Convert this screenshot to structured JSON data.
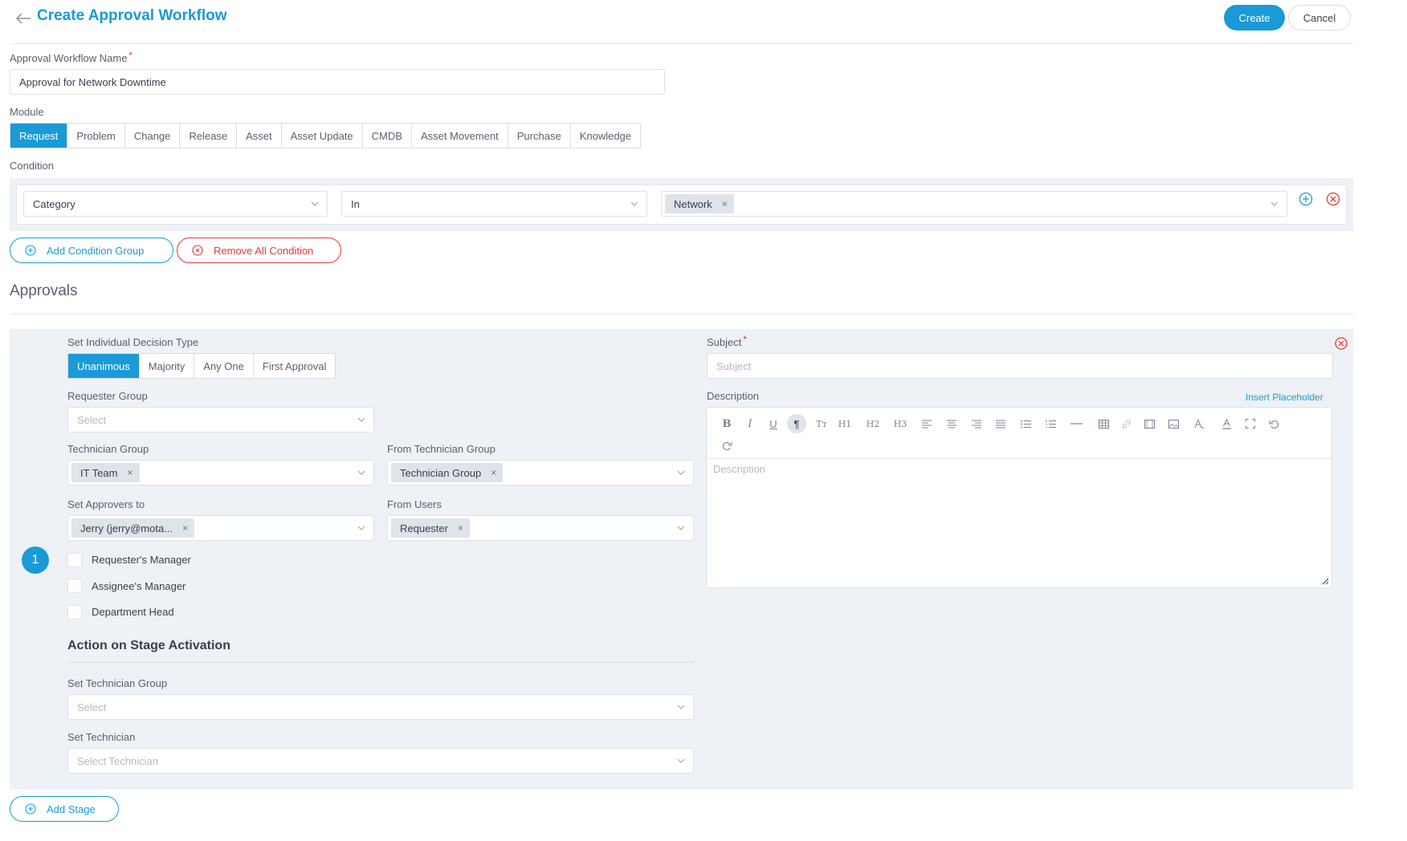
{
  "header": {
    "title": "Create Approval Workflow",
    "create_label": "Create",
    "cancel_label": "Cancel"
  },
  "workflow_name": {
    "label": "Approval Workflow Name",
    "required_mark": "*",
    "value": "Approval for Network Downtime"
  },
  "module": {
    "label": "Module",
    "tabs": [
      "Request",
      "Problem",
      "Change",
      "Release",
      "Asset",
      "Asset Update",
      "CMDB",
      "Asset Movement",
      "Purchase",
      "Knowledge"
    ],
    "active": "Request"
  },
  "condition": {
    "label": "Condition",
    "field": "Category",
    "operator": "In",
    "value_tag": "Network",
    "tag_remove": "×",
    "add_group_label": "Add Condition Group",
    "remove_all_label": "Remove All Condition"
  },
  "approvals": {
    "heading": "Approvals",
    "stage": {
      "number": "1",
      "decision_label": "Set Individual Decision Type",
      "decision_types": [
        "Unanimous",
        "Majority",
        "Any One",
        "First Approval"
      ],
      "decision_active": "Unanimous",
      "requester_group_label": "Requester Group",
      "requester_group_placeholder": "Select",
      "technician_group_label": "Technician Group",
      "technician_group_tag": "IT Team",
      "from_technician_group_label": "From Technician Group",
      "from_technician_group_tag": "Technician Group",
      "set_approvers_label": "Set Approvers to",
      "set_approvers_tag": "Jerry (jerry@mota...",
      "from_users_label": "From Users",
      "from_users_tag": "Requester",
      "checkboxes": [
        "Requester's Manager",
        "Assignee's Manager",
        "Department Head"
      ],
      "action_heading": "Action on Stage Activation",
      "set_technician_group_label": "Set Technician Group",
      "set_technician_group_placeholder": "Select",
      "set_technician_label": "Set Technician",
      "set_technician_placeholder": "Select Technician",
      "subject_label": "Subject",
      "subject_placeholder": "Subject",
      "description_label": "Description",
      "insert_placeholder_label": "Insert Placeholder",
      "description_placeholder": "Description",
      "toolbar": {
        "h1": "H1",
        "h2": "H2",
        "h3": "H3",
        "tt": "Tт"
      }
    },
    "add_stage_label": "Add Stage"
  },
  "colors": {
    "accent": "#1a9ad6",
    "danger": "#e53935",
    "panel": "#eef1f5"
  }
}
